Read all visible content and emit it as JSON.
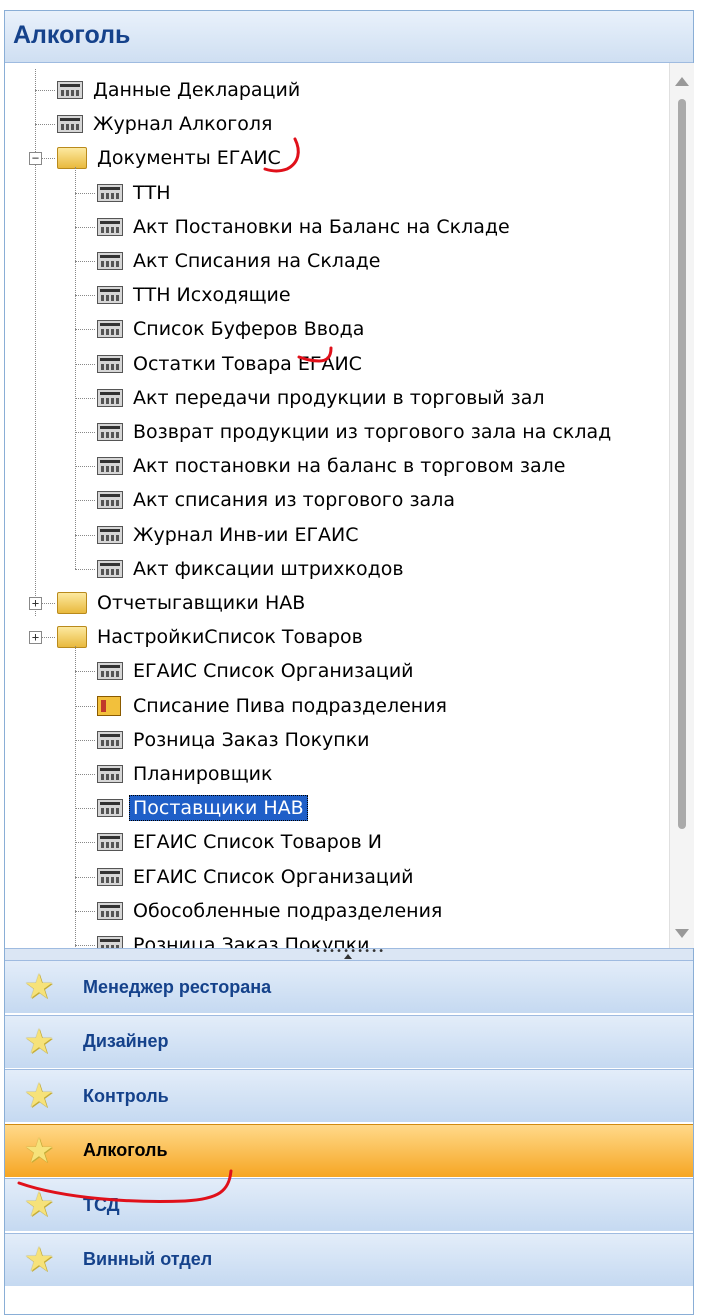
{
  "panel": {
    "title": "Алкоголь"
  },
  "tree": [
    {
      "label": "Данные Деклараций",
      "level": 0,
      "icon": "form-icon"
    },
    {
      "label": "Журнал Алкоголя",
      "level": 0,
      "icon": "form-icon"
    },
    {
      "label": "Документы ЕГАИС",
      "level": 0,
      "icon": "folder-open-icon",
      "expanded": true
    },
    {
      "label": "ТТН",
      "level": 1,
      "icon": "form-icon"
    },
    {
      "label": "Акт Постановки на Баланс на Складе",
      "level": 1,
      "icon": "form-icon"
    },
    {
      "label": "Акт Списания  на Складе",
      "level": 1,
      "icon": "form-icon"
    },
    {
      "label": "ТТН Исходящие",
      "level": 1,
      "icon": "form-icon"
    },
    {
      "label": "Список Буферов Ввода",
      "level": 1,
      "icon": "form-icon"
    },
    {
      "label": "Остатки Товара ЕГАИС",
      "level": 1,
      "icon": "form-icon"
    },
    {
      "label": "Акт передачи продукции в торговый зал",
      "level": 1,
      "icon": "form-icon"
    },
    {
      "label": "Возврат продукции из торгового зала на склад",
      "level": 1,
      "icon": "form-icon"
    },
    {
      "label": "Акт постановки на баланс в торговом зале",
      "level": 1,
      "icon": "form-icon"
    },
    {
      "label": "Акт списания из торгового зала",
      "level": 1,
      "icon": "form-icon"
    },
    {
      "label": "Журнал Инв-ии ЕГАИС",
      "level": 1,
      "icon": "form-icon"
    },
    {
      "label": "Акт фиксации штрихкодов",
      "level": 1,
      "icon": "form-icon"
    },
    {
      "label": "Отчетыгавщики НАВ",
      "level": 0,
      "icon": "folder-icon",
      "expanded": false
    },
    {
      "label": "НастройкиСписок Товаров",
      "level": 0,
      "icon": "folder-icon",
      "expanded": false
    },
    {
      "label": "ЕГАИС Список Организаций",
      "level": 1,
      "icon": "form-icon"
    },
    {
      "label": "Списание Пива подразделения",
      "level": 1,
      "icon": "report-icon"
    },
    {
      "label": "Розница Заказ Покупки",
      "level": 1,
      "icon": "form-icon"
    },
    {
      "label": "Планировщик",
      "level": 1,
      "icon": "form-icon"
    },
    {
      "label": "Поставщики НАВ",
      "level": 1,
      "icon": "form-icon",
      "selected": true
    },
    {
      "label": "ЕГАИС Список Товаров И",
      "level": 1,
      "icon": "form-icon"
    },
    {
      "label": "ЕГАИС Список Организаций",
      "level": 1,
      "icon": "form-icon"
    },
    {
      "label": "Обособленные подразделения",
      "level": 1,
      "icon": "form-icon"
    },
    {
      "label": "Розница Заказ Покупки",
      "level": 1,
      "icon": "form-icon"
    }
  ],
  "nav": [
    {
      "label": "Менеджер ресторана",
      "active": false
    },
    {
      "label": "Дизайнер",
      "active": false
    },
    {
      "label": "Контроль",
      "active": false
    },
    {
      "label": "Алкоголь",
      "active": true
    },
    {
      "label": "ТСД",
      "active": false
    },
    {
      "label": "Винный отдел",
      "active": false
    }
  ],
  "colors": {
    "header_text": "#15428b",
    "active_nav": "#f6a623",
    "selection": "#1f5fc8",
    "annotation": "#e0101a"
  }
}
